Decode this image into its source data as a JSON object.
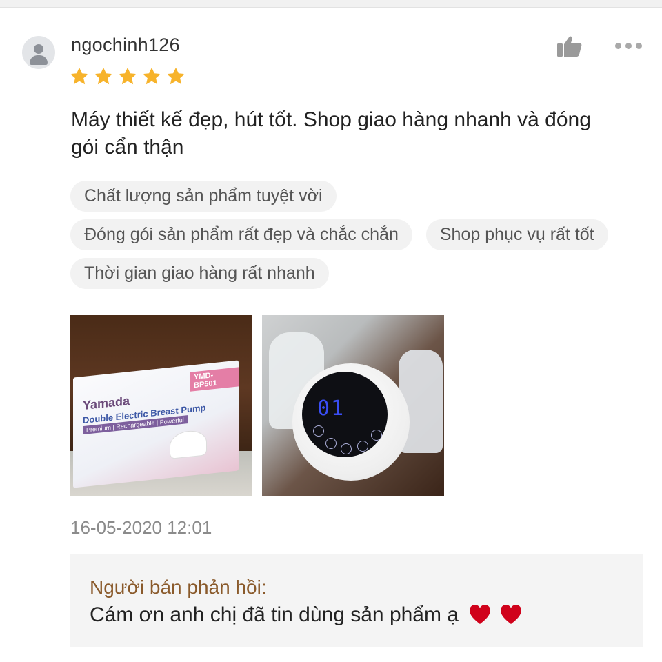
{
  "review": {
    "username": "ngochinh126",
    "rating": 5,
    "rating_max": 5,
    "comment": "Máy thiết kế đẹp, hút tốt. Shop giao hàng nhanh và đóng gói cẩn thận",
    "tags": [
      "Chất lượng sản phẩm tuyệt vời",
      "Đóng gói sản phẩm rất đẹp và chắc chắn",
      "Shop phục vụ rất tốt",
      "Thời gian giao hàng rất nhanh"
    ],
    "photos": {
      "box_brand": "Yamada",
      "box_title": "Double Electric Breast Pump",
      "box_subtitle": "Premium | Rechargeable | Powerful",
      "box_model": "YMD-BP501",
      "display_digits": "01"
    },
    "date": "16-05-2020 12:01"
  },
  "seller_reply": {
    "label": "Người bán phản hồi:",
    "text": "Cám ơn anh chị đã tin dùng sản phẩm ạ"
  },
  "icons": {
    "avatar": "user-avatar-icon",
    "like": "thumbs-up-icon",
    "more": "more-dots-icon",
    "star": "star-icon",
    "heart": "heart-icon"
  },
  "colors": {
    "star": "#f7b32b",
    "heart": "#d0021b",
    "reply_label": "#8a5a2b",
    "tag_bg": "#f2f2f2",
    "reply_bg": "#f4f4f4"
  }
}
